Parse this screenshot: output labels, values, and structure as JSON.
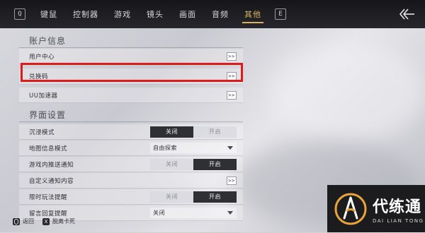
{
  "topbar": {
    "left_key": "Q",
    "right_key": "E",
    "tabs": [
      {
        "label": "键鼠"
      },
      {
        "label": "控制器"
      },
      {
        "label": "游戏"
      },
      {
        "label": "镜头"
      },
      {
        "label": "画面"
      },
      {
        "label": "音频"
      },
      {
        "label": "其他",
        "active": true
      }
    ]
  },
  "account": {
    "title": "账户信息",
    "rows": [
      {
        "label": "用户中心",
        "button": ">>"
      },
      {
        "label": "兑换码",
        "button": ">>",
        "highlighted": true
      },
      {
        "label": "UU加速器",
        "button": ">>"
      }
    ]
  },
  "interface": {
    "title": "界面设置",
    "immersive": {
      "label": "沉浸模式",
      "off": "关闭",
      "on": "开启",
      "selected": "off"
    },
    "map_info": {
      "label": "地图信息模式",
      "value": "自由探索"
    },
    "in_game_notify": {
      "label": "游戏内推送通知",
      "off": "关闭",
      "on": "开启",
      "selected": "on"
    },
    "custom_notify": {
      "label": "自定义通知内容",
      "button": ">>"
    },
    "timed_reminder": {
      "label": "限时玩法提醒",
      "off": "关闭",
      "on": "开启",
      "selected": "on"
    },
    "message_reply": {
      "label": "留言回复提醒",
      "value": "关闭"
    }
  },
  "hints": [
    {
      "key": "",
      "label": "返回"
    },
    {
      "key": "X",
      "label": "脱离卡死"
    }
  ],
  "watermark": {
    "cn": "代练通",
    "en": "DAI LIAN TONG"
  },
  "colors": {
    "accent": "#d9b45a",
    "highlight_box": "#e01a1a",
    "toggle_on": "#2f3033"
  }
}
